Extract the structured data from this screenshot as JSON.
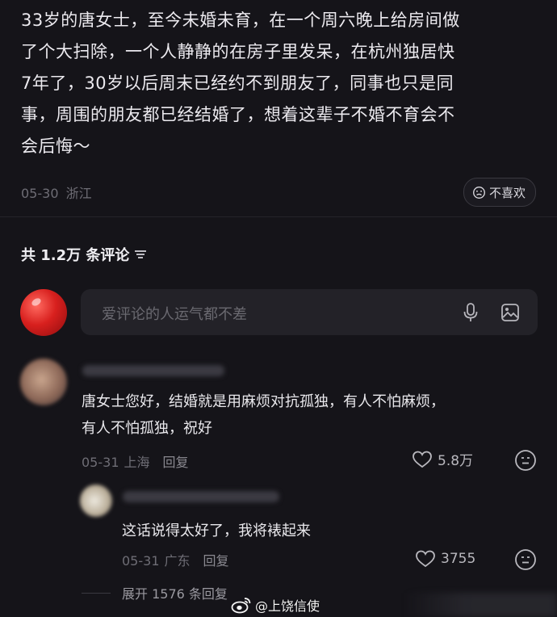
{
  "post": {
    "text": "33岁的唐女士，至今未婚未育，在一个周六晚上给房间做\n了个大扫除，一个人静静的在房子里发呆，在杭州独居快\n7年了，30岁以后周末已经约不到朋友了，同事也只是同\n事，周围的朋友都已经结婚了，想着这辈子不婚不育会不\n会后悔～",
    "date": "05-30",
    "location": "浙江",
    "dislike_label": "不喜欢"
  },
  "comments_header": {
    "count_label": "共 1.2万 条评论"
  },
  "comment_input": {
    "placeholder": "爱评论的人运气都不差"
  },
  "comments": [
    {
      "text": "唐女士您好，结婚就是用麻烦对抗孤独，有人不怕麻烦，\n有人不怕孤独，祝好",
      "date": "05-31",
      "location": "上海",
      "reply_label": "回复",
      "likes": "5.8万"
    },
    {
      "text": "这话说得太好了，我将裱起来",
      "date": "05-31",
      "location": "广东",
      "reply_label": "回复",
      "likes": "3755"
    }
  ],
  "expand_replies": "展开 1576 条回复",
  "watermark": "@上饶信使",
  "icons": {
    "dislike": "sad-face-icon",
    "filter": "filter-lines-icon",
    "mic": "microphone-icon",
    "image": "image-icon",
    "like": "heart-outline-icon",
    "emoji": "neutral-face-icon",
    "weibo": "weibo-logo-icon"
  },
  "colors": {
    "background": "#151419",
    "text": "#eceaef",
    "muted": "#6e6d75"
  }
}
